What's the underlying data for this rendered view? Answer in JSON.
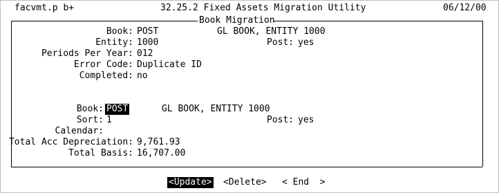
{
  "header": {
    "program": "facvmt.p b+",
    "title": "32.25.2 Fixed Assets Migration Utility",
    "date": "06/12/00"
  },
  "frame1": {
    "caption": "Book Migration",
    "labels": {
      "book": "Book:",
      "entity": "Entity:",
      "periods": "Periods Per Year:",
      "error": "Error Code:",
      "completed": "Completed:",
      "post": "Post:"
    },
    "values": {
      "book": "POST",
      "book_desc": "GL BOOK, ENTITY 1000",
      "entity": "1000",
      "post": "yes",
      "periods": "012",
      "error": "Duplicate ID",
      "completed": "no"
    }
  },
  "frame2": {
    "labels": {
      "book": "Book:",
      "sort": "Sort:",
      "post": "Post:",
      "calendar": "Calendar:",
      "total_dep": "Total Acc Depreciation:",
      "total_basis": "Total Basis:"
    },
    "values": {
      "book": "POST",
      "book_desc": "GL BOOK, ENTITY 1000",
      "sort": "1",
      "post": "yes",
      "calendar": "",
      "total_dep": "9,761.93",
      "total_basis": "16,707.00"
    }
  },
  "actions": {
    "update": "<Update>",
    "delete": "<Delete>",
    "end": "< End  >"
  },
  "colors": {
    "highlight_bg": "#000000",
    "highlight_fg": "#ffffff"
  }
}
